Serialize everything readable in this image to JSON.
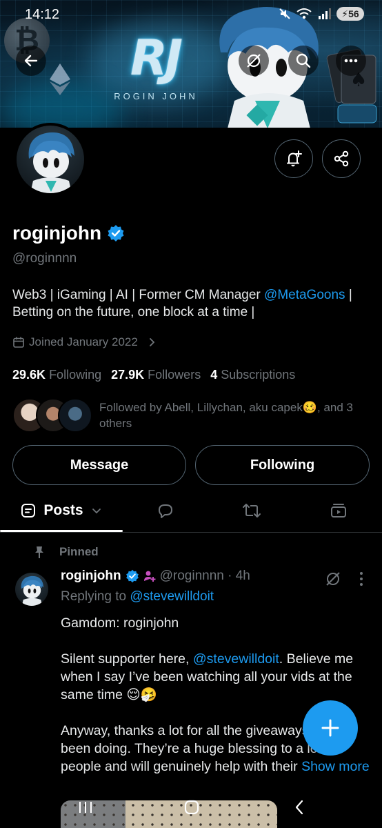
{
  "status_bar": {
    "time": "14:12",
    "battery": "56"
  },
  "profile": {
    "display_name": "roginjohn",
    "handle": "@roginnnn",
    "bio_line1_text": "Web3 | iGaming | AI | Former CM Manager ",
    "bio_line1_mention": "@MetaGoons",
    "bio_line1_tail": " |",
    "bio_line2": "Betting on the future, one block at a time |",
    "joined": "Joined January 2022",
    "following_count": "29.6K",
    "following_label": "Following",
    "followers_count": "27.9K",
    "followers_label": "Followers",
    "subscriptions_count": "4",
    "subscriptions_label": "Subscriptions",
    "followed_by": "Followed by Abell, Lillychan, aku capek🥴, and 3 others"
  },
  "banner": {
    "logo_text": "RJ",
    "logo_subtitle": "ROGIN JOHN"
  },
  "actions": {
    "message_label": "Message",
    "following_label": "Following"
  },
  "tabs": {
    "posts_label": "Posts"
  },
  "post": {
    "pinned_label": "Pinned",
    "author_name": "roginjohn",
    "author_meta": "@roginnnn · 4h",
    "replying_prefix": "Replying to ",
    "replying_to": "@stevewilldoit",
    "para1": "Gamdom: roginjohn",
    "para2_text": "Silent supporter here, ",
    "para2_mention": "@stevewilldoit",
    "para2_tail": ". Believe me when I say I’ve been watching all your vids at the same time 😌🤧",
    "para3_text": "Anyway, thanks a lot for all the giveaways you’ve been doing. They’re a huge blessing to a lot of people and will genuinely help with their ",
    "show_more": "Show more"
  },
  "colors": {
    "accent": "#1d9bf0",
    "background": "#000000",
    "secondary_text": "#71767b",
    "border": "#536471"
  },
  "icons": [
    "back-arrow-icon",
    "hide-icon",
    "search-icon",
    "more-icon",
    "notification-add-icon",
    "share-icon",
    "verified-badge-icon",
    "calendar-icon",
    "chevron-right-icon",
    "chevron-down-icon",
    "reply-icon",
    "repost-icon",
    "media-icon",
    "pin-icon",
    "plus-icon"
  ]
}
